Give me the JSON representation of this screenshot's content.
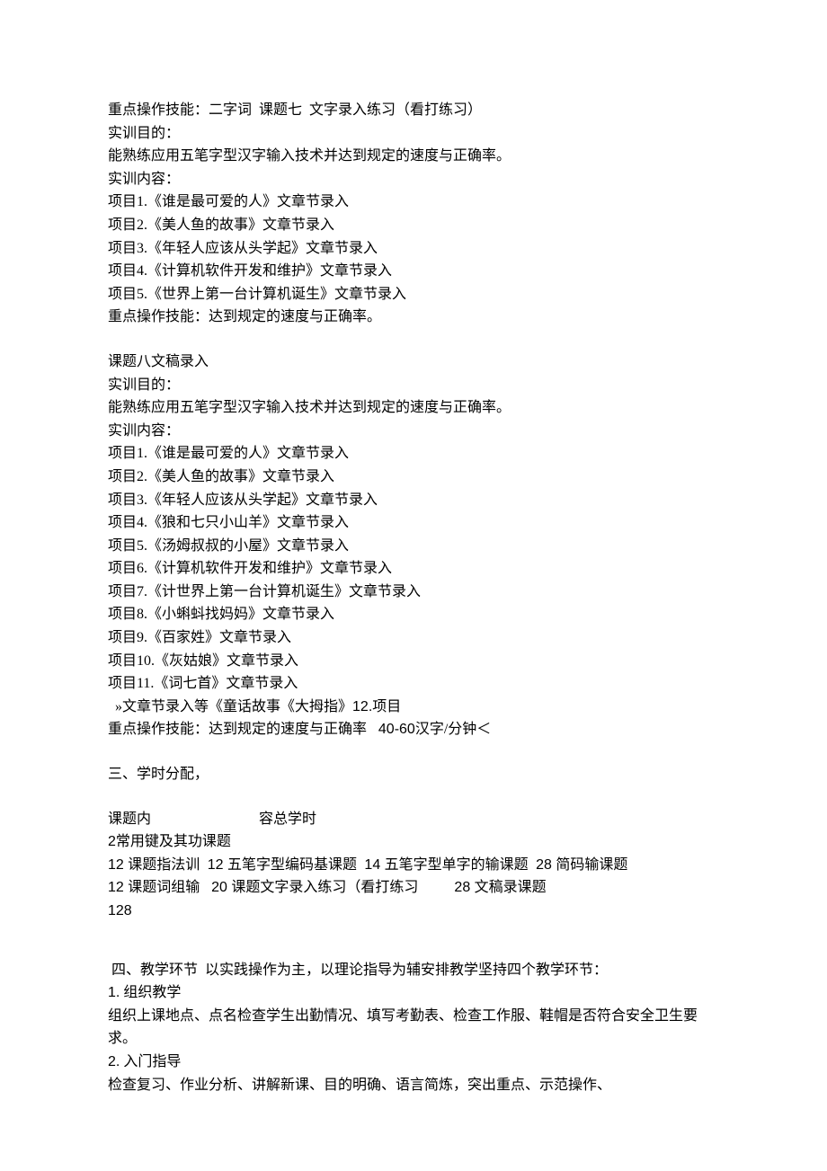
{
  "section_a": {
    "l1": "重点操作技能：二字词  课题七  文字录入练习（看打练习）",
    "l2": "实训目的：",
    "l3": "能熟练应用五笔字型汉字输入技术并达到规定的速度与正确率。",
    "l4": "实训内容：",
    "p": [
      {
        "no": "项目1.",
        "txt": "《谁是最可爱的人》文章节录入"
      },
      {
        "no": "项目2.",
        "txt": "《美人鱼的故事》文章节录入"
      },
      {
        "no": "项目3.",
        "txt": "《年轻人应该从头学起》文章节录入"
      },
      {
        "no": "项目4.",
        "txt": "《计算机软件开发和维护》文章节录入"
      },
      {
        "no": "项目5.",
        "txt": "《世界上第一台计算机诞生》文章节录入"
      }
    ],
    "l5": "重点操作技能：达到规定的速度与正确率。"
  },
  "section_b": {
    "l1": "课题八文稿录入",
    "l2": "实训目的：",
    "l3": "能熟练应用五笔字型汉字输入技术并达到规定的速度与正确率。",
    "l4": "实训内容：",
    "p": [
      {
        "no": "项目1.",
        "txt": "《谁是最可爱的人》文章节录入"
      },
      {
        "no": "项目2.",
        "txt": "《美人鱼的故事》文章节录入"
      },
      {
        "no": "项目3.",
        "txt": "《年轻人应该从头学起》文章节录入"
      },
      {
        "no": "项目4.",
        "txt": "《狼和七只小山羊》文章节录入"
      },
      {
        "no": "项目5.",
        "txt": "《汤姆叔叔的小屋》文章节录入"
      },
      {
        "no": "项目6.",
        "txt": "《计算机软件开发和维护》文章节录入"
      },
      {
        "no": "项目7.",
        "txt": "《计世界上第一台计算机诞生》文章节录入"
      },
      {
        "no": "项目8.",
        "txt": "《小蝌蚪找妈妈》文章节录入"
      },
      {
        "no": "项目9.",
        "txt": "《百家姓》文章节录入"
      },
      {
        "no": "项目10.",
        "txt": "《灰姑娘》文章节录入"
      },
      {
        "no": "项目11.",
        "txt": "《词七首》文章节录入"
      }
    ],
    "l5a": "  »文章节录入等《童话故事《大拇指》",
    "l5b": "12.",
    "l5c": "项目",
    "l6a": "重点操作技能：达到规定的速度与正确率 ",
    "l6b": "  40-60",
    "l6c": "汉字/分钟＜"
  },
  "section_c": {
    "l1": "三、学时分配，",
    "l2a": "课题内",
    "l2b": "容总学时",
    "l3a": "2",
    "l3b": "常用键及其功课题",
    "l4": [
      {
        "n": "12 ",
        "t": "课题指法训 "
      },
      {
        "n": " 12 ",
        "t": "五笔字型编码基课题 "
      },
      {
        "n": " 14 ",
        "t": "五笔字型单字的输课题 "
      },
      {
        "n": " 28 ",
        "t": "简码输课题"
      }
    ],
    "l5": [
      {
        "n": "12 ",
        "t": "课题词组输 "
      },
      {
        "n": "  20 ",
        "t": "课题文字录入练习（看打练习"
      },
      {
        "n": "         28 ",
        "t": "文稿录课题"
      }
    ],
    "l6": "128"
  },
  "section_d": {
    "l1": " 四、教学环节  以实践操作为主，以理论指导为辅安排教学坚持四个教学环节：",
    "l2a": "1.",
    "l2b": " 组织教学",
    "l3": "组织上课地点、点名检查学生出勤情况、填写考勤表、检查工作服、鞋帽是否符合安全卫生要求。",
    "l4a": "2.",
    "l4b": " 入门指导",
    "l5": "检查复习、作业分析、讲解新课、目的明确、语言简炼，突出重点、示范操作、"
  }
}
